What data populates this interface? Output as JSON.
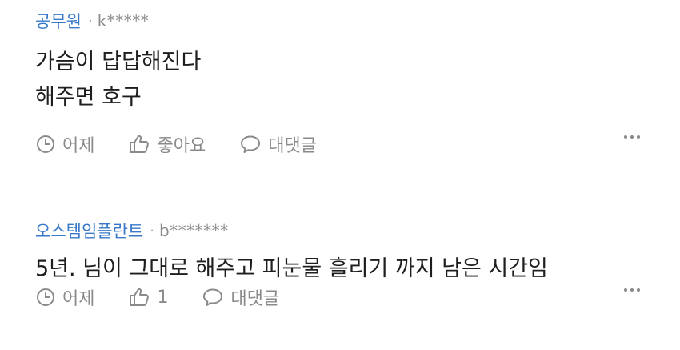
{
  "comments": [
    {
      "author": "공무원",
      "separator": "·",
      "user_id": "k*****",
      "lines": [
        "가슴이 답답해진다",
        "해주면 호구"
      ],
      "time_label": "어제",
      "like_label": "좋아요",
      "reply_label": "대댓글"
    },
    {
      "author": "오스템임플란트",
      "separator": "·",
      "user_id": "b*******",
      "lines": [
        "5년. 님이 그대로 해주고 피눈물 흘리기 까지 남은 시간임"
      ],
      "time_label": "어제",
      "like_label": "1",
      "reply_label": "대댓글"
    }
  ],
  "icons": {
    "time": "clock-icon",
    "like": "thumbs-up-icon",
    "reply": "speech-bubble-icon",
    "more": "more-dots-icon"
  },
  "colors": {
    "author": "#3a79c9",
    "muted": "#8a8a8a",
    "text": "#1e1e1e",
    "divider": "#e8e8e8"
  }
}
